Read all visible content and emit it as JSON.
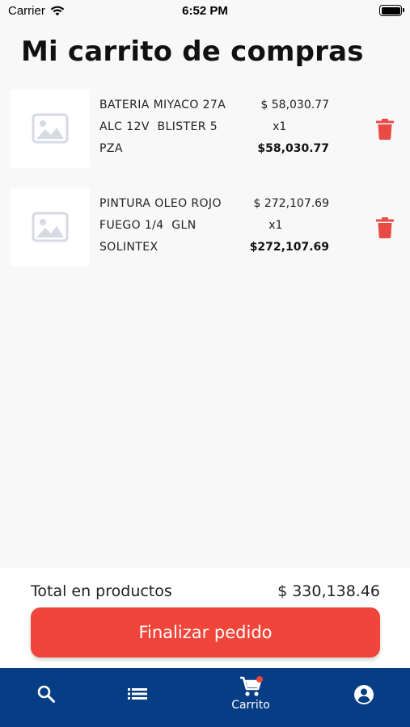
{
  "status_bar": {
    "carrier": "Carrier",
    "time": "6:52 PM"
  },
  "page_title": "Mi carrito de compras",
  "cart": {
    "items": [
      {
        "name_lines": [
          "BATERIA MIYACO 27A",
          "ALC 12V  BLISTER 5",
          "PZA"
        ],
        "unit_price": "$ 58,030.77",
        "quantity": "x1",
        "subtotal": "$58,030.77",
        "image_icon": "image-placeholder-icon",
        "delete_icon": "trash-icon"
      },
      {
        "name_lines": [
          "PINTURA OLEO ROJO",
          "FUEGO 1/4  GLN",
          "SOLINTEX"
        ],
        "unit_price": "$ 272,107.69",
        "quantity": "x1",
        "subtotal": "$272,107.69",
        "image_icon": "image-placeholder-icon",
        "delete_icon": "trash-icon"
      }
    ]
  },
  "summary": {
    "total_label": "Total en productos",
    "total_value": "$ 330,138.46",
    "checkout_label": "Finalizar pedido"
  },
  "tab_bar": {
    "tabs": [
      {
        "icon": "search-icon",
        "label": ""
      },
      {
        "icon": "list-icon",
        "label": ""
      },
      {
        "icon": "cart-icon",
        "label": "Carrito",
        "active": true,
        "badge_dot": true
      },
      {
        "icon": "account-icon",
        "label": ""
      }
    ]
  },
  "colors": {
    "accent": "#f0453a",
    "tab_bar_bg": "#073d84",
    "background": "#f8f8f9",
    "placeholder_icon": "#d7dae3"
  }
}
